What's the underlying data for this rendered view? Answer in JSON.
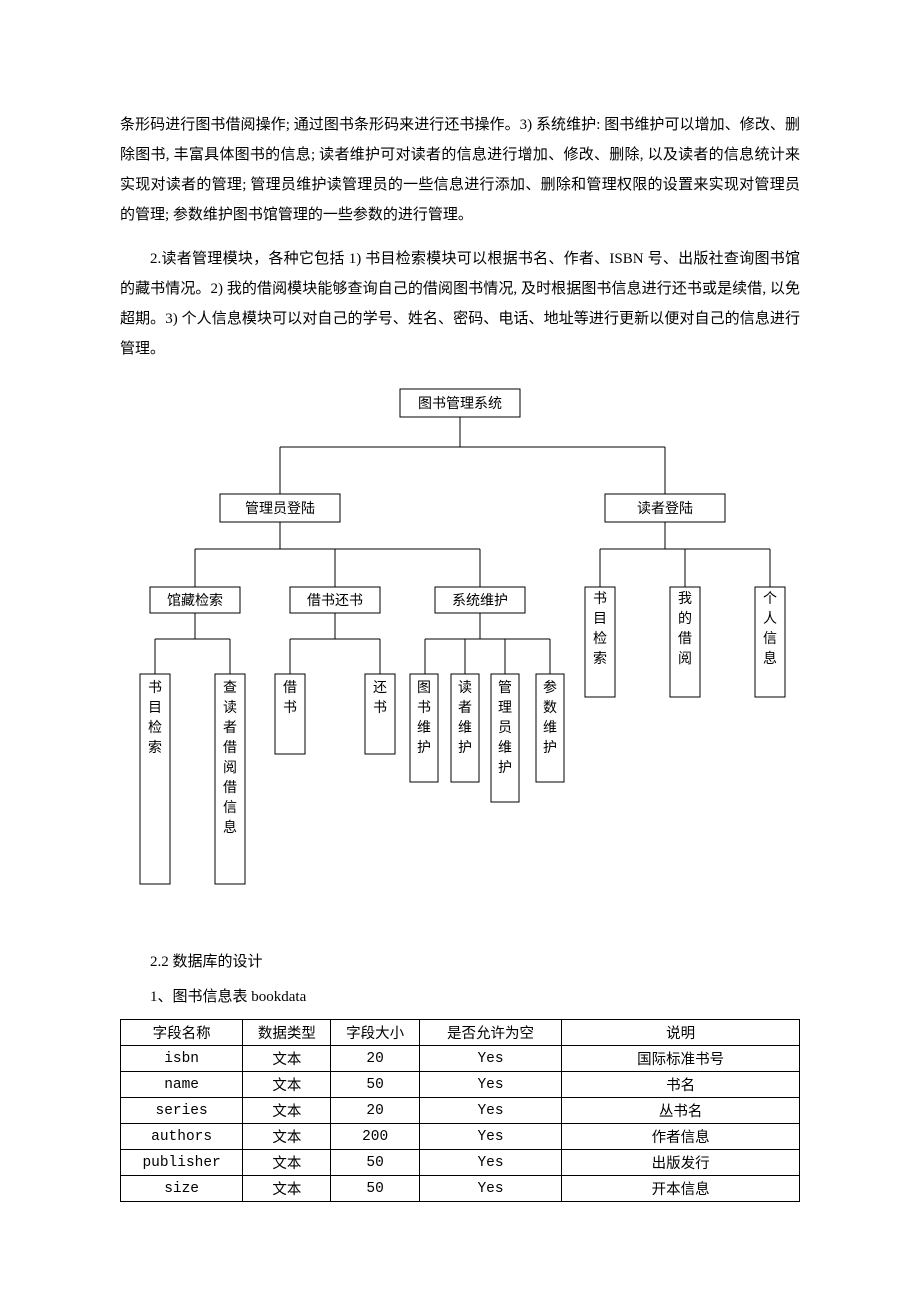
{
  "paragraphs": {
    "p1": "条形码进行图书借阅操作; 通过图书条形码来进行还书操作。3) 系统维护: 图书维护可以增加、修改、删除图书, 丰富具体图书的信息; 读者维护可对读者的信息进行增加、修改、删除, 以及读者的信息统计来实现对读者的管理; 管理员维护读管理员的一些信息进行添加、删除和管理权限的设置来实现对管理员的管理; 参数维护图书馆管理的一些参数的进行管理。",
    "p2": "2.读者管理模块，各种它包括 1) 书目检索模块可以根据书名、作者、ISBN 号、出版社查询图书馆的藏书情况。2) 我的借阅模块能够查询自己的借阅图书情况, 及时根据图书信息进行还书或是续借, 以免超期。3) 个人信息模块可以对自己的学号、姓名、密码、电话、地址等进行更新以便对自己的信息进行管理。"
  },
  "diagram": {
    "root": "图书管理系统",
    "left": {
      "label": "管理员登陆",
      "children": {
        "c1": {
          "label": "馆藏检索",
          "leaves": [
            "书目检索",
            "查读者借阅借信息"
          ]
        },
        "c2": {
          "label": "借书还书",
          "leaves": [
            "借书",
            "还书"
          ]
        },
        "c3": {
          "label": "系统维护",
          "leaves": [
            "图书维护",
            "读者维护",
            "管理员维护",
            "参数维护"
          ]
        }
      }
    },
    "right": {
      "label": "读者登陆",
      "leaves": [
        "书目检索",
        "我的借阅",
        "个人信息"
      ]
    }
  },
  "section": {
    "db_heading": "2.2 数据库的设计",
    "table1_caption": "1、图书信息表 bookdata",
    "headers": [
      "字段名称",
      "数据类型",
      "字段大小",
      "是否允许为空",
      "说明"
    ],
    "rows": [
      [
        "isbn",
        "文本",
        "20",
        "Yes",
        "国际标准书号"
      ],
      [
        "name",
        "文本",
        "50",
        "Yes",
        "书名"
      ],
      [
        "series",
        "文本",
        "20",
        "Yes",
        "丛书名"
      ],
      [
        "authors",
        "文本",
        "200",
        "Yes",
        "作者信息"
      ],
      [
        "publisher",
        "文本",
        "50",
        "Yes",
        "出版发行"
      ],
      [
        "size",
        "文本",
        "50",
        "Yes",
        "开本信息"
      ]
    ]
  }
}
